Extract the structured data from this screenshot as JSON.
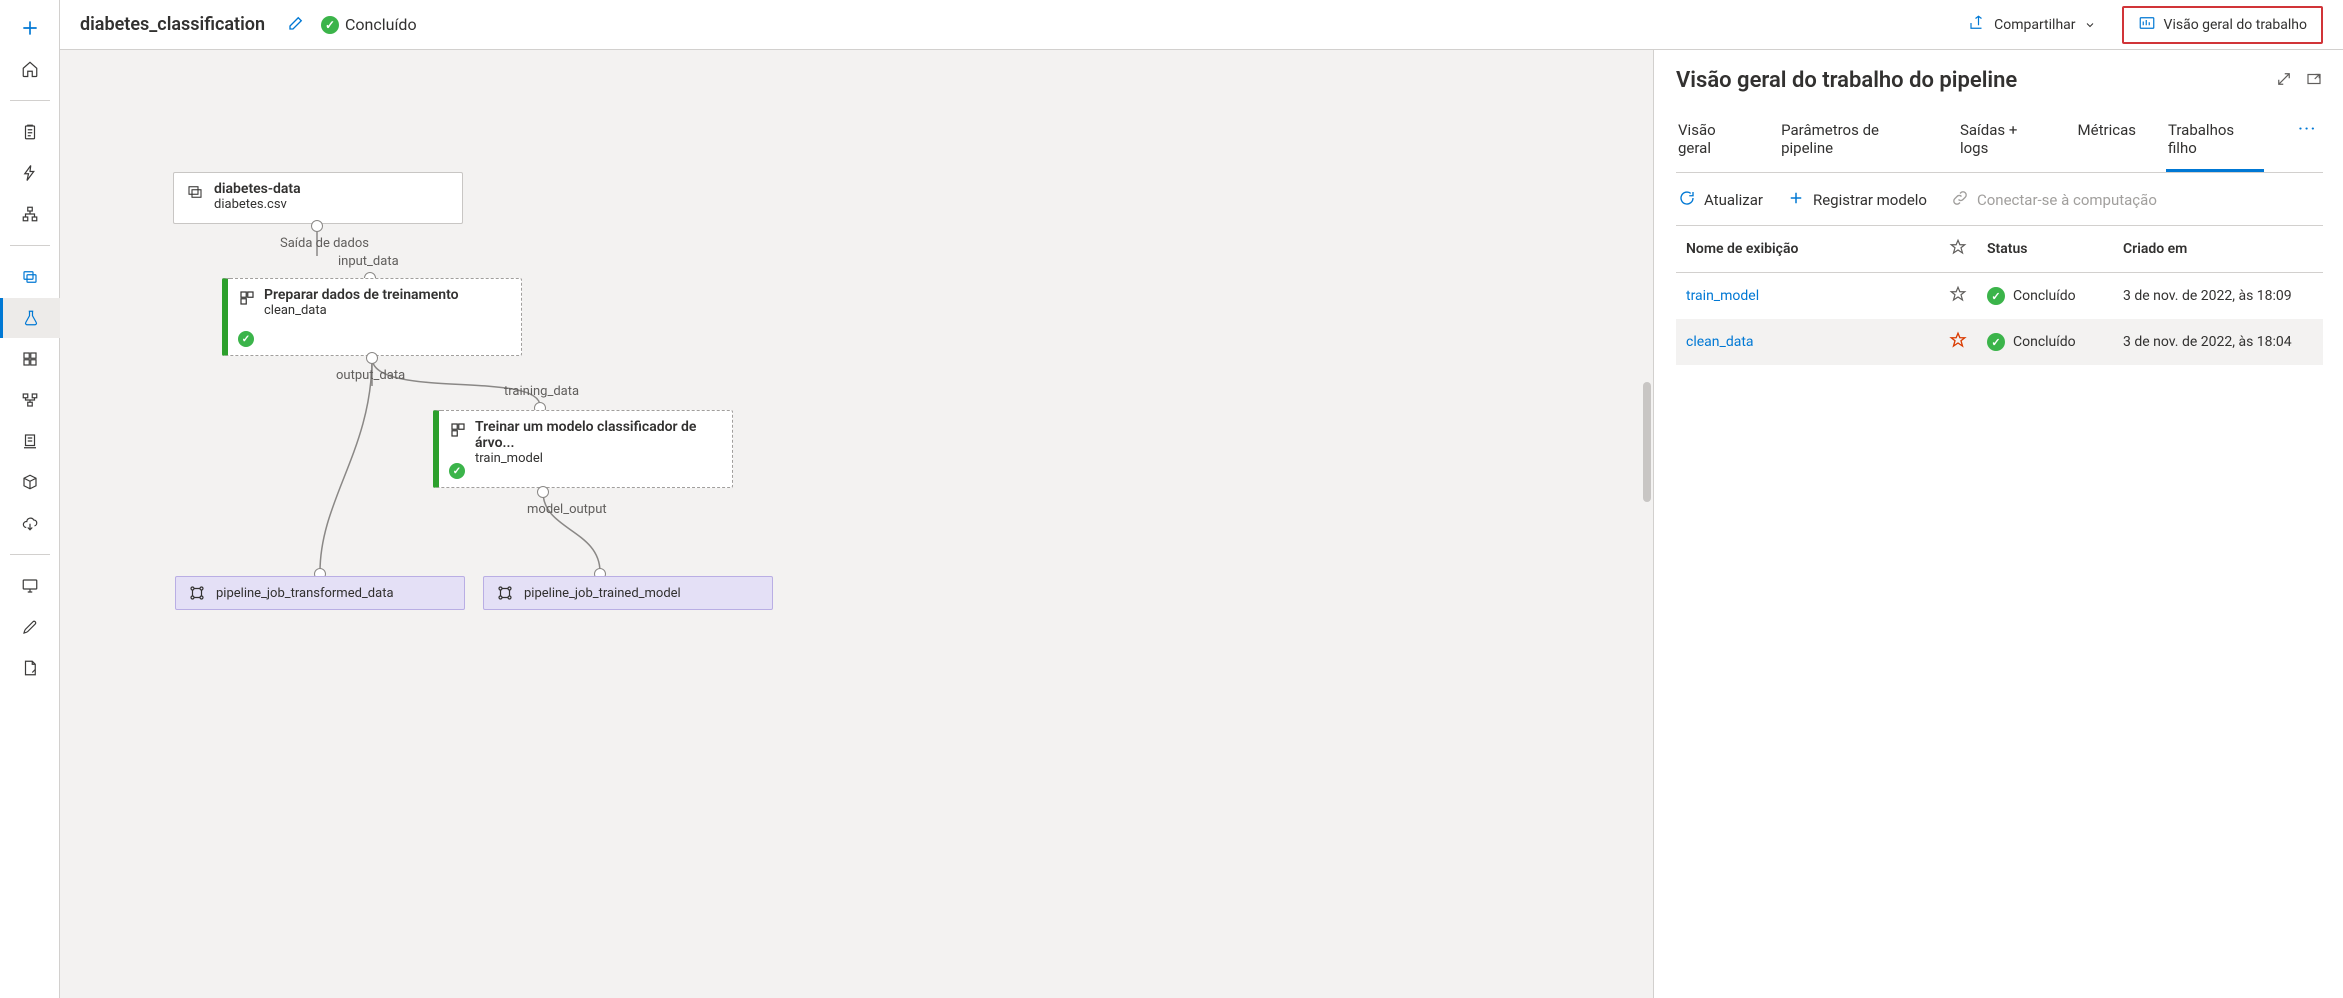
{
  "topbar": {
    "job_name": "diabetes_classification",
    "status_label": "Concluído",
    "share_label": "Compartilhar",
    "overview_label": "Visão geral do trabalho"
  },
  "canvas": {
    "data_node": {
      "title": "diabetes-data",
      "subtitle": "diabetes.csv"
    },
    "data_out_label": "Saída de dados",
    "step1_in_label": "input_data",
    "step1": {
      "title": "Preparar dados de treinamento",
      "subtitle": "clean_data"
    },
    "step1_out_label": "output_data",
    "step2_in_label": "training_data",
    "step2": {
      "title": "Treinar um modelo classificador de árvo...",
      "subtitle": "train_model"
    },
    "step2_out_label": "model_output",
    "output1": "pipeline_job_transformed_data",
    "output2": "pipeline_job_trained_model"
  },
  "panel": {
    "title": "Visão geral do trabalho do pipeline",
    "tabs": [
      "Visão geral",
      "Parâmetros de pipeline",
      "Saídas + logs",
      "Métricas",
      "Trabalhos filho"
    ],
    "active_tab_index": 4,
    "toolbar": {
      "refresh": "Atualizar",
      "register": "Registrar modelo",
      "connect": "Conectar-se à computação"
    },
    "columns": {
      "name": "Nome de exibição",
      "status": "Status",
      "created": "Criado em"
    },
    "rows": [
      {
        "name": "train_model",
        "starred": false,
        "status": "Concluído",
        "created": "3 de nov. de 2022, às 18:09"
      },
      {
        "name": "clean_data",
        "starred": true,
        "status": "Concluído",
        "created": "3 de nov. de 2022, às 18:04"
      }
    ]
  },
  "sidebar_icons": [
    "plus",
    "home",
    "sep",
    "clipboard",
    "lightning",
    "hierarchy",
    "sep",
    "layers",
    "flask",
    "components",
    "pipeline",
    "workstation",
    "cube",
    "cloud",
    "sep",
    "monitor",
    "pen",
    "note"
  ]
}
